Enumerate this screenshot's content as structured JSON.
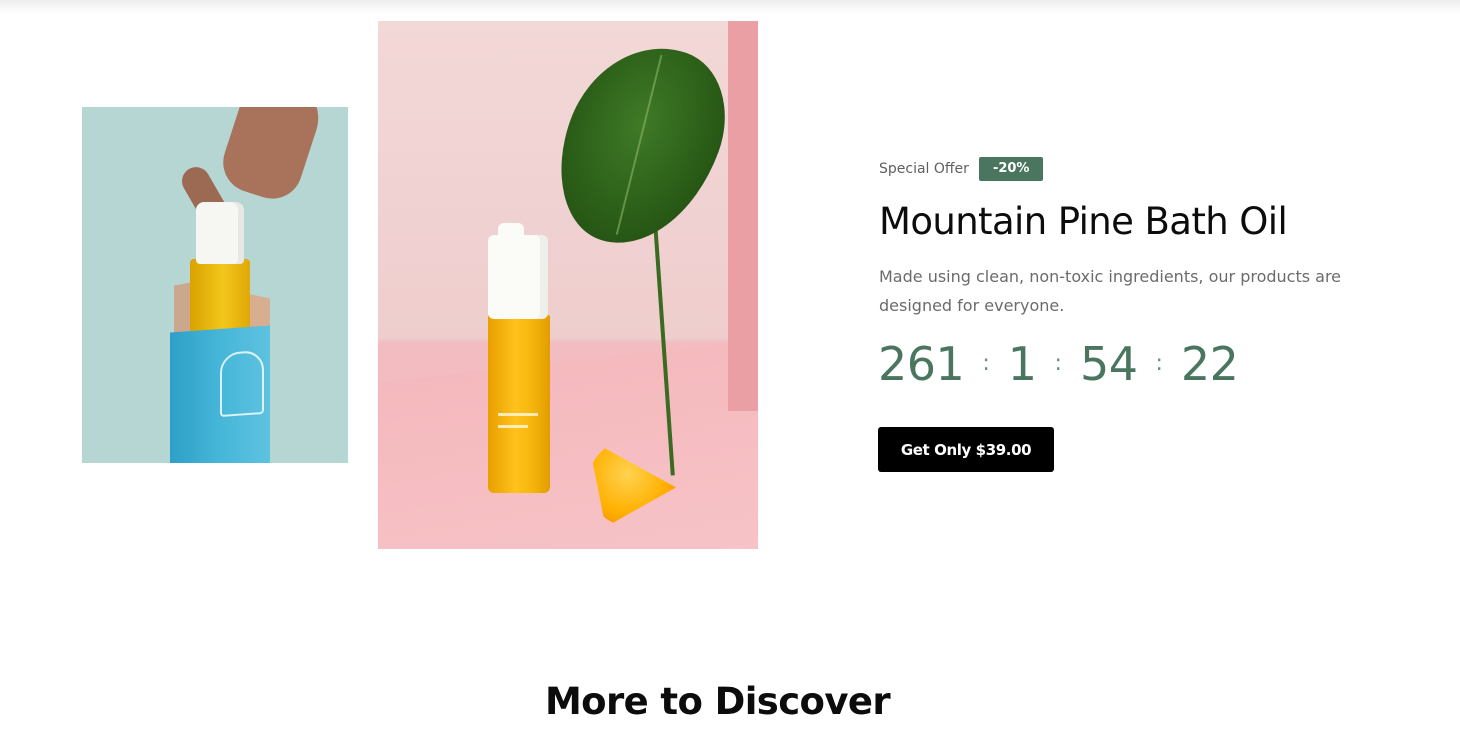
{
  "offer": {
    "label": "Special Offer",
    "discount_badge": "-20%",
    "title": "Mountain Pine Bath Oil",
    "description": "Made using clean, non-toxic ingredients, our products are designed for everyone.",
    "countdown": {
      "days": "261",
      "hours": "1",
      "minutes": "54",
      "seconds": "22",
      "separator": ":"
    },
    "button_label": "Get Only $39.00"
  },
  "images": {
    "small": "product-box-photo",
    "large": "product-bottle-leaf-photo"
  },
  "discover": {
    "title": "More to Discover"
  },
  "colors": {
    "accent": "#4a7660",
    "button_bg": "#000000",
    "text_dark": "#0c0c0c",
    "text_muted": "#6b6b6b"
  }
}
